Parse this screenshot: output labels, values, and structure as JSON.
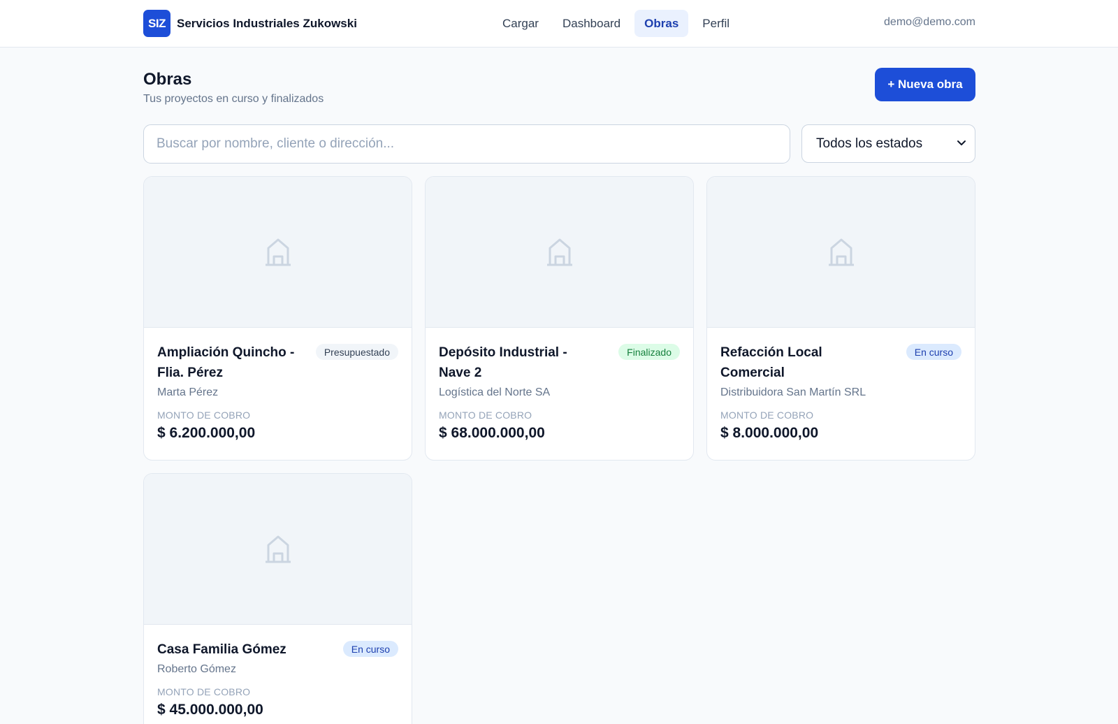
{
  "header": {
    "logo": "SIZ",
    "company": "Servicios Industriales Zukowski",
    "nav": [
      {
        "label": "Cargar",
        "active": false
      },
      {
        "label": "Dashboard",
        "active": false
      },
      {
        "label": "Obras",
        "active": true
      },
      {
        "label": "Perfil",
        "active": false
      }
    ],
    "user_email": "demo@demo.com"
  },
  "page": {
    "title": "Obras",
    "subtitle": "Tus proyectos en curso y finalizados",
    "new_button": "+ Nueva obra"
  },
  "filters": {
    "search_placeholder": "Buscar por nombre, cliente o dirección...",
    "status_selected": "Todos los estados"
  },
  "cards": [
    {
      "title": "Ampliación Quincho - Flia. Pérez",
      "client": "Marta Pérez",
      "status": "Presupuestado",
      "amount_label": "MONTO DE COBRO",
      "amount": "$ 6.200.000,00"
    },
    {
      "title": "Depósito Industrial - Nave 2",
      "client": "Logística del Norte SA",
      "status": "Finalizado",
      "amount_label": "MONTO DE COBRO",
      "amount": "$ 68.000.000,00"
    },
    {
      "title": "Refacción Local Comercial",
      "client": "Distribuidora San Martín SRL",
      "status": "En curso",
      "amount_label": "MONTO DE COBRO",
      "amount": "$ 8.000.000,00"
    },
    {
      "title": "Casa Familia Gómez",
      "client": "Roberto Gómez",
      "status": "En curso",
      "amount_label": "MONTO DE COBRO",
      "amount": "$ 45.000.000,00"
    }
  ],
  "colors": {
    "accent": "#1d4ed8",
    "status_presupuestado": "#f1f5f9",
    "status_finalizado": "#dcfce7",
    "status_en_curso": "#dbeafe"
  }
}
